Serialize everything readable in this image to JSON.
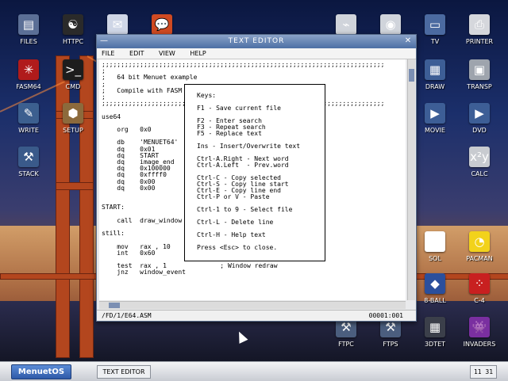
{
  "desktop": {
    "icons": [
      {
        "label": "FILES",
        "glyph": "▤",
        "color": "#5b6f96"
      },
      {
        "label": "HTTPC",
        "glyph": "☯",
        "color": "#2a2a2a"
      },
      {
        "label": "MAIL",
        "glyph": "✉",
        "color": "#cfd6e6"
      },
      {
        "label": "CHAT",
        "glyph": "💬",
        "color": "#cf4a22"
      },
      {
        "label": "USB",
        "glyph": "⌁",
        "color": "#d0d4db"
      },
      {
        "label": "WEBCAM",
        "glyph": "◉",
        "color": "#d0d4db"
      },
      {
        "label": "TV",
        "glyph": "▭",
        "color": "#4b6aa0"
      },
      {
        "label": "PRINTER",
        "glyph": "⎙",
        "color": "#d5d7dc"
      },
      {
        "label": "FASM64",
        "glyph": "✳",
        "color": "#b01b1b"
      },
      {
        "label": "CMD",
        "glyph": ">_",
        "color": "#1d1d1d"
      },
      {
        "label": "DRAW",
        "glyph": "▦",
        "color": "#3d5e96"
      },
      {
        "label": "TRANSP",
        "glyph": "▣",
        "color": "#9ea4ad"
      },
      {
        "label": "WRITE",
        "glyph": "✎",
        "color": "#3c5f8f"
      },
      {
        "label": "SETUP",
        "glyph": "⬢",
        "color": "#8c6a3c"
      },
      {
        "label": "MOVIE",
        "glyph": "▶",
        "color": "#3d5e96"
      },
      {
        "label": "DVD",
        "glyph": "▶",
        "color": "#3d5e96"
      },
      {
        "label": "STACK",
        "glyph": "⚒",
        "color": "#3a5a8a"
      },
      {
        "label": "CALC",
        "glyph": "x²y",
        "color": "#c8cbd0"
      },
      {
        "label": "SOL",
        "glyph": "🂡",
        "color": "#ffffff"
      },
      {
        "label": "PACMAN",
        "glyph": "◔",
        "color": "#f2d21b"
      },
      {
        "label": "8-BALL",
        "glyph": "◆",
        "color": "#2b4f9c"
      },
      {
        "label": "C-4",
        "glyph": "⁘",
        "color": "#c82020"
      },
      {
        "label": "FTPC",
        "glyph": "⚒",
        "color": "#4b5e7e"
      },
      {
        "label": "FTPS",
        "glyph": "⚒",
        "color": "#4b5e7e"
      },
      {
        "label": "3DTET",
        "glyph": "▦",
        "color": "#3b3f4a"
      },
      {
        "label": "INVADERS",
        "glyph": "👾",
        "color": "#7a2fa0"
      }
    ]
  },
  "window": {
    "title": "TEXT EDITOR",
    "menu": [
      "FILE",
      "EDIT",
      "VIEW",
      "HELP"
    ],
    "lines": [
      ";;;;;;;;;;;;;;;;;;;;;;;;;;;;;;;;;;;;;;;;;;;;;;;;;;;;;;;;;;;;;;;;;;;;;;;;;;",
      ";",
      ";   64 bit Menuet example",
      ";",
      ";   Compile with FASM",
      ";",
      ";;;;;;;;;;;;;;;;;;;;;;;;;;;;;;;;;;;;;;;;;;;;;;;;;;;;;;;;;;;;;;;;;;;;;;;;;;",
      "",
      "use64",
      "",
      "    org   0x0",
      "",
      "    db    'MENUET64'",
      "    dq    0x01",
      "    dq    START",
      "    dq    image_end",
      "    dq    0x100000",
      "    dq    0xffff0",
      "    dq    0x00",
      "    dq    0x00",
      "",
      "",
      "START:",
      "",
      "    call  draw_window",
      "",
      "still:",
      "",
      "    mov   rax , 10",
      "    int   0x60",
      "",
      "    test  rax , 1              ; Window redraw",
      "    jnz   window_event"
    ],
    "status_path": "/FD/1/E64.ASM",
    "status_position": "00001:001"
  },
  "popup": {
    "lines": [
      "Keys:",
      "",
      "F1 - Save current file",
      "",
      "F2 - Enter search",
      "F3 - Repeat search",
      "F5 - Replace text",
      "",
      "Ins - Insert/Overwrite text",
      "",
      "Ctrl-A.Right - Next word",
      "Ctrl-A.Left  - Prev.word",
      "",
      "Ctrl-C - Copy selected",
      "Ctrl-S - Copy line start",
      "Ctrl-E - Copy line end",
      "Ctrl-P or V - Paste",
      "",
      "Ctrl-1 to 9 - Select file",
      "",
      "Ctrl-L - Delete line",
      "",
      "Ctrl-H - Help text",
      "",
      "Press <Esc> to close."
    ]
  },
  "taskbar": {
    "start_label": "MenuetOS",
    "task_label": "TEXT EDITOR",
    "clock": "11 31"
  }
}
